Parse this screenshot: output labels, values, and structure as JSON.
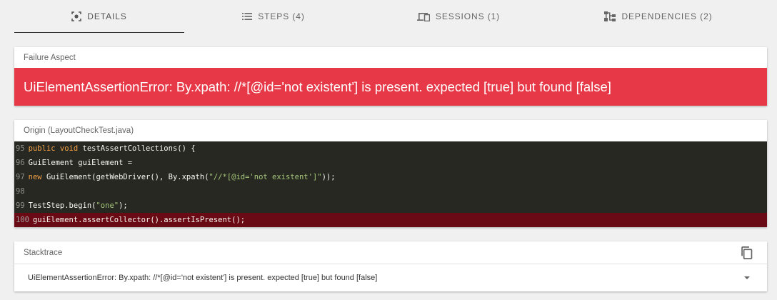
{
  "tabs": [
    {
      "label": "DETAILS",
      "icon": "details-icon",
      "active": true
    },
    {
      "label": "STEPS (4)",
      "icon": "list-icon",
      "active": false
    },
    {
      "label": "SESSIONS (1)",
      "icon": "devices-icon",
      "active": false
    },
    {
      "label": "DEPENDENCIES (2)",
      "icon": "hierarchy-icon",
      "active": false
    }
  ],
  "failure": {
    "title": "Failure Aspect",
    "message": "UiElementAssertionError: By.xpath: //*[@id='not existent'] is present. expected [true] but found [false]",
    "color": "#e63846"
  },
  "origin": {
    "title": "Origin (LayoutCheckTest.java)",
    "lines": [
      {
        "num": "95",
        "parts": [
          {
            "t": "public void",
            "c": "kw"
          },
          {
            "t": " testAssertCollections() {",
            "c": ""
          }
        ]
      },
      {
        "num": "96",
        "parts": [
          {
            "t": "GuiElement guiElement =",
            "c": ""
          }
        ]
      },
      {
        "num": "97",
        "parts": [
          {
            "t": "new",
            "c": "kw"
          },
          {
            "t": " GuiElement(getWebDriver(), By.xpath(",
            "c": ""
          },
          {
            "t": "\"//*[@id='not existent']\"",
            "c": "str"
          },
          {
            "t": "));",
            "c": ""
          }
        ]
      },
      {
        "num": "98",
        "parts": []
      },
      {
        "num": "99",
        "parts": [
          {
            "t": "TestStep.begin(",
            "c": ""
          },
          {
            "t": "\"one\"",
            "c": "str"
          },
          {
            "t": ");",
            "c": ""
          }
        ]
      },
      {
        "num": "100",
        "parts": [
          {
            "t": "guiElement.assertCollector().assertIsPresent();",
            "c": ""
          }
        ],
        "error": true
      }
    ]
  },
  "stacktrace": {
    "title": "Stacktrace",
    "copy_icon": "copy-icon",
    "summary": "UiElementAssertionError: By.xpath: //*[@id='not existent'] is present. expected [true] but found [false]",
    "expand_icon": "caret-down-icon"
  }
}
